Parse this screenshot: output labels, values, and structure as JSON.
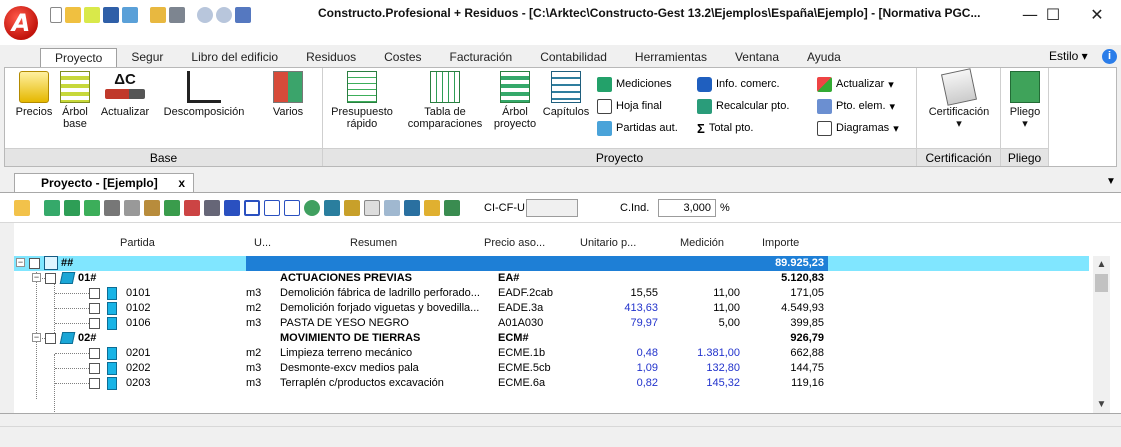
{
  "app": {
    "logo_letter": "A",
    "title": "Constructo.Profesional + Residuos - [C:\\Arktec\\Constructo-Gest 13.2\\Ejemplos\\España\\Ejemplo] - [Normativa PGC...",
    "window_controls": {
      "minimize": "—",
      "maximize": "☐",
      "close": "✕"
    }
  },
  "menu": {
    "tabs": [
      "Proyecto",
      "Segur",
      "Libro del edificio",
      "Residuos",
      "Costes",
      "Facturación",
      "Contabilidad",
      "Herramientas",
      "Ventana",
      "Ayuda"
    ],
    "active": "Proyecto",
    "estilo": "Estilo",
    "help_icon": "i"
  },
  "ribbon": {
    "base": {
      "label": "Base",
      "buttons": [
        {
          "label": "Precios",
          "icon": "database-icon"
        },
        {
          "label": "Árbol\nbase",
          "icon": "tree-icon"
        },
        {
          "label": "Actualizar",
          "icon": "currency-icon",
          "big_text": "ΔC"
        },
        {
          "label": "Descomposición",
          "icon": "decompose-icon"
        },
        {
          "label": "Varios",
          "icon": "misc-icon"
        }
      ]
    },
    "proyecto": {
      "label": "Proyecto",
      "buttons": [
        {
          "label": "Presupuesto\nrápido",
          "icon": "budget-icon"
        },
        {
          "label": "Tabla de\ncomparaciones",
          "icon": "table-edit-icon"
        },
        {
          "label": "Árbol\nproyecto",
          "icon": "tree-icon"
        },
        {
          "label": "Capítulos",
          "icon": "chapters-icon"
        }
      ],
      "small": [
        {
          "label": "Mediciones",
          "icon": "measurements-icon"
        },
        {
          "label": "Hoja final",
          "icon": "sheet-icon"
        },
        {
          "label": "Partidas aut.",
          "icon": "items-icon"
        },
        {
          "label": "Info. comerc.",
          "icon": "info-icon"
        },
        {
          "label": "Recalcular pto.",
          "icon": "recalc-icon"
        },
        {
          "label": "Total pto.",
          "icon": "sum-icon",
          "prefix": "Σ"
        },
        {
          "label": "Actualizar",
          "icon": "update-icon"
        },
        {
          "label": "Pto. elem.",
          "icon": "element-icon"
        },
        {
          "label": "Diagramas",
          "icon": "diagram-icon"
        }
      ]
    },
    "certificacion": {
      "label": "Certificación",
      "button": "Certificación"
    },
    "pliego": {
      "label": "Pliego",
      "button": "Pliego"
    }
  },
  "document_tab": {
    "label": "Proyecto - [Ejemplo]",
    "close": "x"
  },
  "toolbar": {
    "cicfu_label": "CI-CF-U",
    "cicfu_value": "",
    "cind_label": "C.Ind.",
    "cind_value": "3,000",
    "cind_unit": "%"
  },
  "grid": {
    "columns": [
      "Partida",
      "U...",
      "Resumen",
      "Precio aso...",
      "Unitario p...",
      "Medición",
      "Importe"
    ],
    "root": {
      "code": "##",
      "importe": "89.925,23"
    },
    "rows": [
      {
        "type": "chapter",
        "code": "01#",
        "unit": "",
        "resumen": "ACTUACIONES PREVIAS",
        "precio": "EA#",
        "unitario": "",
        "medicion": "",
        "importe": "5.120,83"
      },
      {
        "type": "item",
        "code": "0101",
        "unit": "m3",
        "resumen": "Demolición fábrica de ladrillo perforado...",
        "precio": "EADF.2cab",
        "unitario": "15,55",
        "unit_blue": false,
        "medicion": "11,00",
        "med_blue": false,
        "importe": "171,05"
      },
      {
        "type": "item",
        "code": "0102",
        "unit": "m2",
        "resumen": "Demolición forjado viguetas y bovedilla...",
        "precio": "EADE.3a",
        "unitario": "413,63",
        "unit_blue": true,
        "medicion": "11,00",
        "med_blue": false,
        "importe": "4.549,93"
      },
      {
        "type": "item",
        "code": "0106",
        "unit": "m3",
        "resumen": "PASTA DE YESO NEGRO",
        "precio": "A01A030",
        "unitario": "79,97",
        "unit_blue": true,
        "medicion": "5,00",
        "med_blue": false,
        "importe": "399,85"
      },
      {
        "type": "chapter",
        "code": "02#",
        "unit": "",
        "resumen": "MOVIMIENTO DE TIERRAS",
        "precio": "ECM#",
        "unitario": "",
        "medicion": "",
        "importe": "926,79"
      },
      {
        "type": "item",
        "code": "0201",
        "unit": "m2",
        "resumen": "Limpieza terreno mecánico",
        "precio": "ECME.1b",
        "unitario": "0,48",
        "unit_blue": true,
        "medicion": "1.381,00",
        "med_blue": true,
        "importe": "662,88"
      },
      {
        "type": "item",
        "code": "0202",
        "unit": "m3",
        "resumen": "Desmonte-excv medios pala",
        "precio": "ECME.5cb",
        "unitario": "1,09",
        "unit_blue": true,
        "medicion": "132,80",
        "med_blue": true,
        "importe": "144,75"
      },
      {
        "type": "item",
        "code": "0203",
        "unit": "m3",
        "resumen": "Terraplén c/productos excavación",
        "precio": "ECME.6a",
        "unitario": "0,82",
        "unit_blue": true,
        "medicion": "145,32",
        "med_blue": true,
        "importe": "119,16"
      }
    ]
  },
  "scrollbar": {
    "up": "▲",
    "down": "▼"
  }
}
